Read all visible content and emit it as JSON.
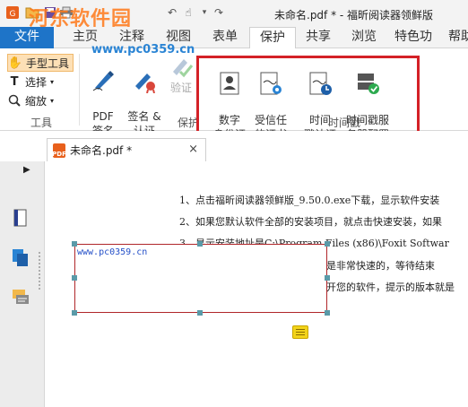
{
  "window": {
    "title": "未命名.pdf * - 福昕阅读器领鲜版",
    "watermark": "河东软件园",
    "watermark_url": "www.pc0359.cn"
  },
  "quick_access": {
    "icons": [
      "app-logo-icon",
      "open-icon",
      "save-icon",
      "print-icon",
      "undo-icon",
      "redo-icon",
      "hand-icon",
      "dropdown-icon"
    ]
  },
  "tabs": [
    {
      "label": "文件"
    },
    {
      "label": "主页"
    },
    {
      "label": "注释"
    },
    {
      "label": "视图"
    },
    {
      "label": "表单"
    },
    {
      "label": "保护"
    },
    {
      "label": "共享"
    },
    {
      "label": "浏览"
    },
    {
      "label": "特色功"
    },
    {
      "label": "帮助"
    }
  ],
  "active_tab": "保护",
  "tools_group": {
    "hand": "手型工具",
    "select": "选择",
    "zoom": "缩放",
    "label": "工具"
  },
  "protect_group": {
    "pdf_sign": "PDF\n签名",
    "sign_cert": "签名 &\n认证",
    "verify": "验证",
    "label": "保护"
  },
  "digital_id_group": {
    "digital_id": "数字\n身份证",
    "trusted_cert": "受信任\n的证书"
  },
  "timestamp_group": {
    "timestamp_cert": "时间\n戳认证",
    "timestamp_server": "时间戳服\n务器配置",
    "label": "时间戳"
  },
  "doc_tab": {
    "name": "未命名.pdf *",
    "close": "×",
    "icon_text": "PDF"
  },
  "document": {
    "lines": [
      "1、点击福昕阅读器领鲜版_9.50.0.exe下载，显示软件安装",
      "2、如果您默认软件全部的安装项目，就点击快速安装，如果",
      "3、显示安装地址是C:\\Program Files (x86)\\Foxit Softwar",
      "是非常快速的，等待结束",
      "开您的软件，提示的版本就是"
    ],
    "textbox_text": "www.pc0359.cn"
  },
  "colors": {
    "file_tab": "#1e74c8",
    "highlight": "#d42127",
    "annotation_border": "#b0262a",
    "watermark": "#ff7a1a"
  }
}
